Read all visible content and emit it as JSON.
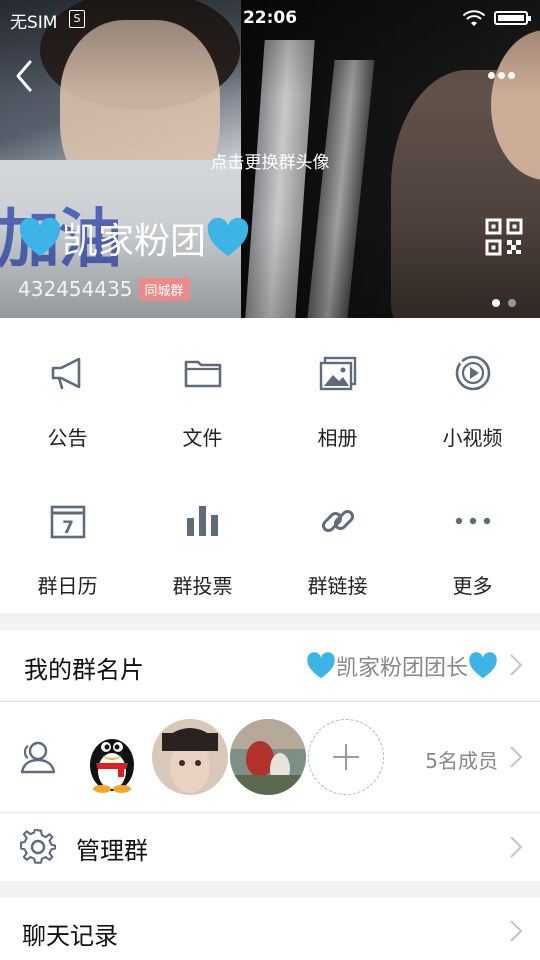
{
  "status_bar": {
    "carrier": "无SIM",
    "sim_icon": "S",
    "time": "22:06"
  },
  "header": {
    "change_avatar_hint": "点击更换群头像",
    "photo_text": "加油",
    "group_name": "凯家粉团",
    "group_id": "432454435",
    "group_tag": "同城群",
    "heart_color": "#3cb4e6",
    "page_indicator": {
      "count": 2,
      "active": 0
    }
  },
  "grid": {
    "items": [
      {
        "label": "公告",
        "icon": "megaphone-icon"
      },
      {
        "label": "文件",
        "icon": "folder-icon"
      },
      {
        "label": "相册",
        "icon": "photo-album-icon"
      },
      {
        "label": "小视频",
        "icon": "video-play-icon"
      },
      {
        "label": "群日历",
        "icon": "calendar-icon",
        "calendar_day": "7"
      },
      {
        "label": "群投票",
        "icon": "bar-chart-icon"
      },
      {
        "label": "群链接",
        "icon": "link-icon"
      },
      {
        "label": "更多",
        "icon": "more-dots-icon"
      }
    ]
  },
  "card": {
    "title": "我的群名片",
    "value": "凯家粉团团长"
  },
  "members": {
    "count_label": "5名成员"
  },
  "manage": {
    "title": "管理群"
  },
  "chat_history": {
    "title": "聊天记录"
  },
  "colors": {
    "icon_gray": "#5f6b7a",
    "heart_blue": "#3cb4e6",
    "tag_pink": "#e98b8b"
  }
}
